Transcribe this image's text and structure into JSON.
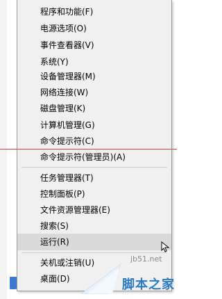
{
  "menu": {
    "items": [
      {
        "label": "程序和功能(F)"
      },
      {
        "label": "电源选项(O)"
      },
      {
        "label": "事件查看器(V)"
      },
      {
        "label": "系统(Y)"
      },
      {
        "label": "设备管理器(M)"
      },
      {
        "label": "网络连接(W)"
      },
      {
        "label": "磁盘管理(K)"
      },
      {
        "label": "计算机管理(G)"
      },
      {
        "label": "命令提示符(C)"
      },
      {
        "label": "命令提示符(管理员)(A)"
      },
      {
        "label": "任务管理器(T)"
      },
      {
        "label": "控制面板(P)"
      },
      {
        "label": "文件资源管理器(E)"
      },
      {
        "label": "搜索(S)"
      },
      {
        "label": "运行(R)",
        "highlighted": true
      },
      {
        "label": "关机或注销(U)"
      },
      {
        "label": "桌面(D)"
      }
    ]
  },
  "watermark": {
    "site": "jb51.net",
    "name": "脚本之家"
  },
  "colors": {
    "menu_background": "#f0f0f0",
    "highlight": "#dadada",
    "separator": "#cfcfcf",
    "annotation_line": "#d6464b",
    "watermark_blue": "#2a7bc8"
  }
}
